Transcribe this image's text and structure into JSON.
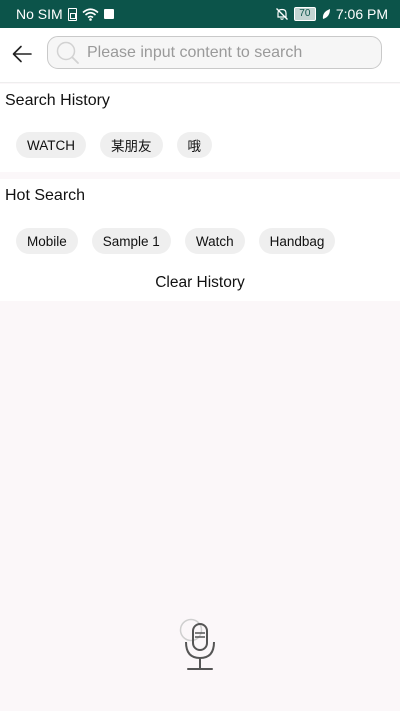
{
  "status_bar": {
    "carrier": "No SIM",
    "battery_level": "70",
    "time": "7:06 PM"
  },
  "search": {
    "placeholder": "Please input content to search",
    "value": ""
  },
  "history": {
    "title": "Search History",
    "items": [
      "WATCH",
      "某朋友",
      "哦"
    ]
  },
  "hot": {
    "title": "Hot Search",
    "items": [
      "Mobile",
      "Sample 1",
      "Watch",
      "Handbag"
    ]
  },
  "clear_history_label": "Clear History",
  "colors": {
    "status_bar_bg": "#0c544a",
    "chip_bg": "#efefef",
    "page_bg": "#fbf7f9"
  },
  "icons": [
    "sim-icon",
    "wifi-icon",
    "bell-off-icon",
    "battery-icon",
    "leaf-icon",
    "back-icon",
    "search-icon",
    "microphone-icon"
  ]
}
